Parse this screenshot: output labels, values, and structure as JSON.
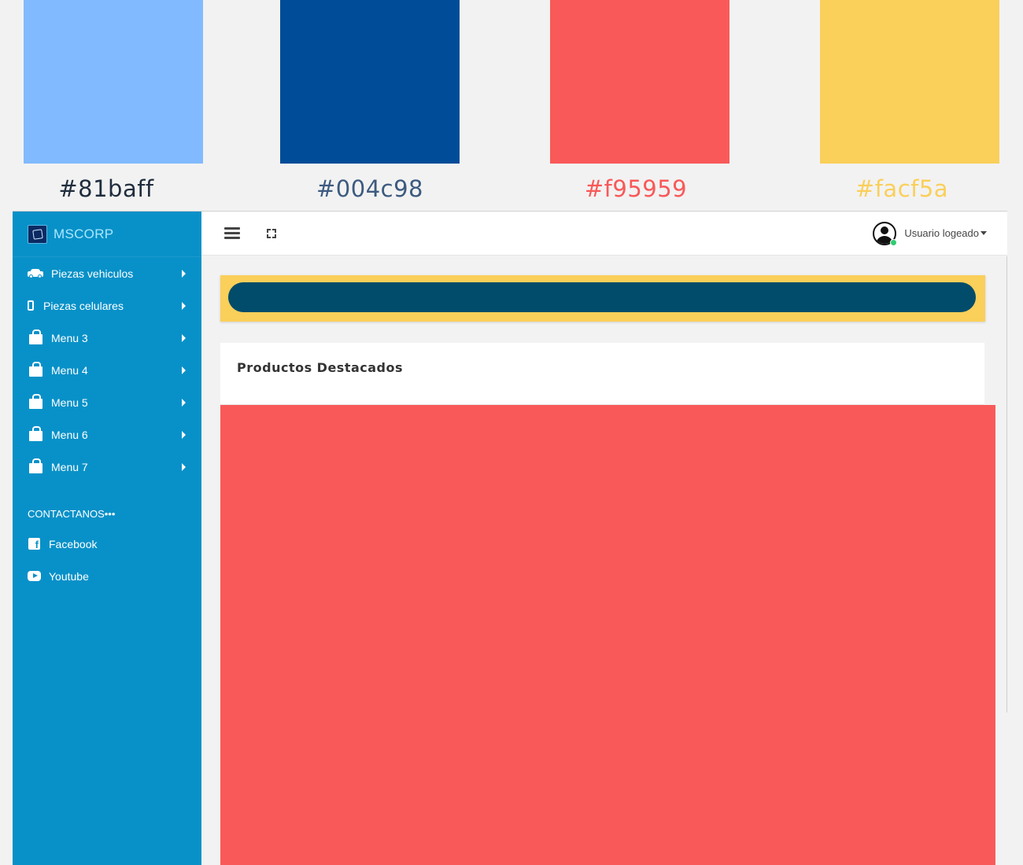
{
  "palette": [
    {
      "hex": "#81baff",
      "label": "#81baff",
      "label_color": "#1f2d3d"
    },
    {
      "hex": "#004c98",
      "label": "#004c98",
      "label_color": "#3d5a80"
    },
    {
      "hex": "#f95959",
      "label": "#f95959",
      "label_color": "#f95959"
    },
    {
      "hex": "#facf5a",
      "label": "#facf5a",
      "label_color": "#facf5a"
    }
  ],
  "brand": {
    "name": "MSCORP"
  },
  "sidebar": {
    "items": [
      {
        "label": "Piezas vehiculos",
        "icon": "car-icon"
      },
      {
        "label": "Piezas celulares",
        "icon": "mobile-phone-icon"
      },
      {
        "label": "Menu 3",
        "icon": "shopping-bag-icon"
      },
      {
        "label": "Menu 4",
        "icon": "shopping-bag-icon"
      },
      {
        "label": "Menu 5",
        "icon": "shopping-bag-icon"
      },
      {
        "label": "Menu 6",
        "icon": "shopping-bag-icon"
      },
      {
        "label": "Menu 7",
        "icon": "shopping-bag-icon"
      }
    ],
    "contact_title": "CONTACTANOS•••",
    "social": [
      {
        "label": "Facebook",
        "icon": "facebook-icon"
      },
      {
        "label": "Youtube",
        "icon": "youtube-icon"
      }
    ]
  },
  "topbar": {
    "menu_icon": "hamburger-icon",
    "fullscreen_icon": "expand-icon",
    "user_label": "Usuario logeado"
  },
  "search": {
    "value": "",
    "placeholder": ""
  },
  "main": {
    "products_title": "Productos Destacados"
  },
  "colors": {
    "sidebar": "#0891c8",
    "banner": "#facf5a",
    "search_bar": "#004c6a",
    "products_area": "#f95959"
  }
}
